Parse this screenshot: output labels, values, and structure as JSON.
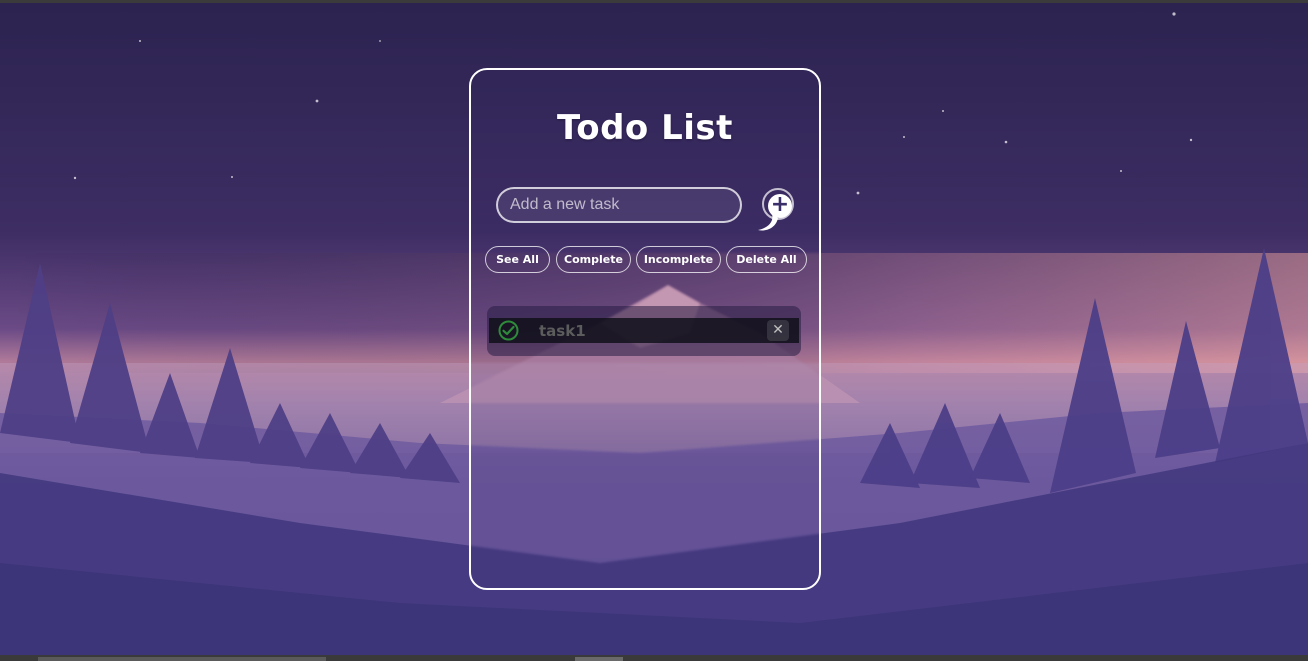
{
  "app": {
    "title": "Todo List"
  },
  "input": {
    "placeholder": "Add a new task",
    "value": ""
  },
  "add_button": {
    "icon": "plus-icon",
    "symbol": "+"
  },
  "filters": [
    {
      "label": "See All"
    },
    {
      "label": "Complete"
    },
    {
      "label": "Incomplete"
    },
    {
      "label": "Delete All"
    }
  ],
  "tasks": [
    {
      "label": "task1",
      "completed": true,
      "check_icon": "check-circle-icon",
      "delete_icon": "close-icon",
      "delete_symbol": "✕"
    }
  ],
  "colors": {
    "accent": "#ffffff",
    "check": "#2e8b3a",
    "task_text": "#5c5c5c"
  }
}
